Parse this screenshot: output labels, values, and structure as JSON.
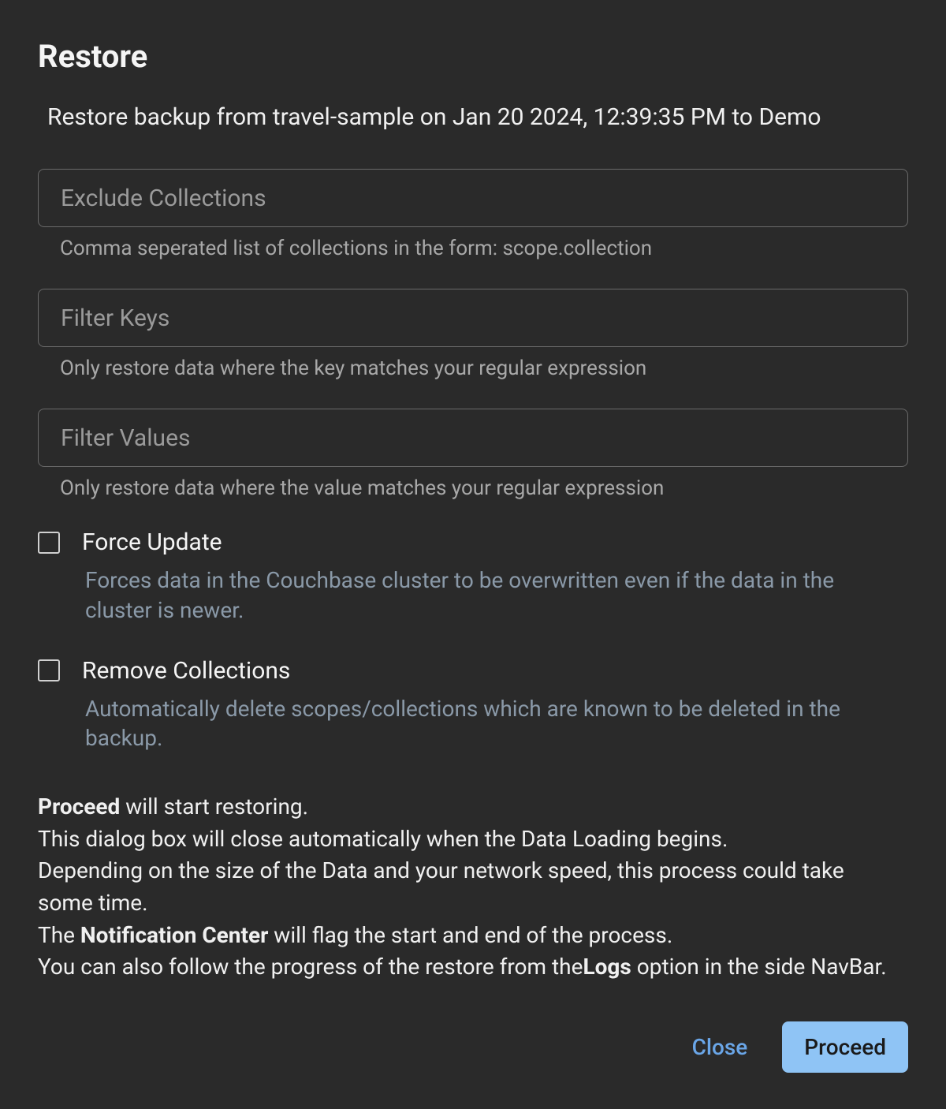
{
  "dialog": {
    "title": "Restore",
    "subtitle": "Restore backup from travel-sample on Jan 20 2024, 12:39:35 PM to Demo"
  },
  "fields": {
    "excludeCollections": {
      "placeholder": "Exclude Collections",
      "value": "",
      "hint": "Comma seperated list of collections in the form: scope.collection"
    },
    "filterKeys": {
      "placeholder": "Filter Keys",
      "value": "",
      "hint": "Only restore data where the key matches your regular expression"
    },
    "filterValues": {
      "placeholder": "Filter Values",
      "value": "",
      "hint": "Only restore data where the value matches your regular expression"
    }
  },
  "checkboxes": {
    "forceUpdate": {
      "label": "Force Update",
      "desc": "Forces data in the Couchbase cluster to be overwritten even if the data in the cluster is newer.",
      "checked": false
    },
    "removeCollections": {
      "label": "Remove Collections",
      "desc": "Automatically delete scopes/collections which are known to be deleted in the backup.",
      "checked": false
    }
  },
  "info": {
    "proceedBold": "Proceed",
    "line1_rest": " will start restoring.",
    "line2": "This dialog box will close automatically when the Data Loading begins.",
    "line3": "Depending on the size of the Data and your network speed, this process could take some time.",
    "line4_a": "The ",
    "notificationBold": "Notification Center",
    "line4_b": " will flag the start and end of the process.",
    "line5_a": "You can also follow the progress of the restore from the",
    "logsBold": "Logs",
    "line5_b": " option in the side NavBar."
  },
  "buttons": {
    "close": "Close",
    "proceed": "Proceed"
  }
}
